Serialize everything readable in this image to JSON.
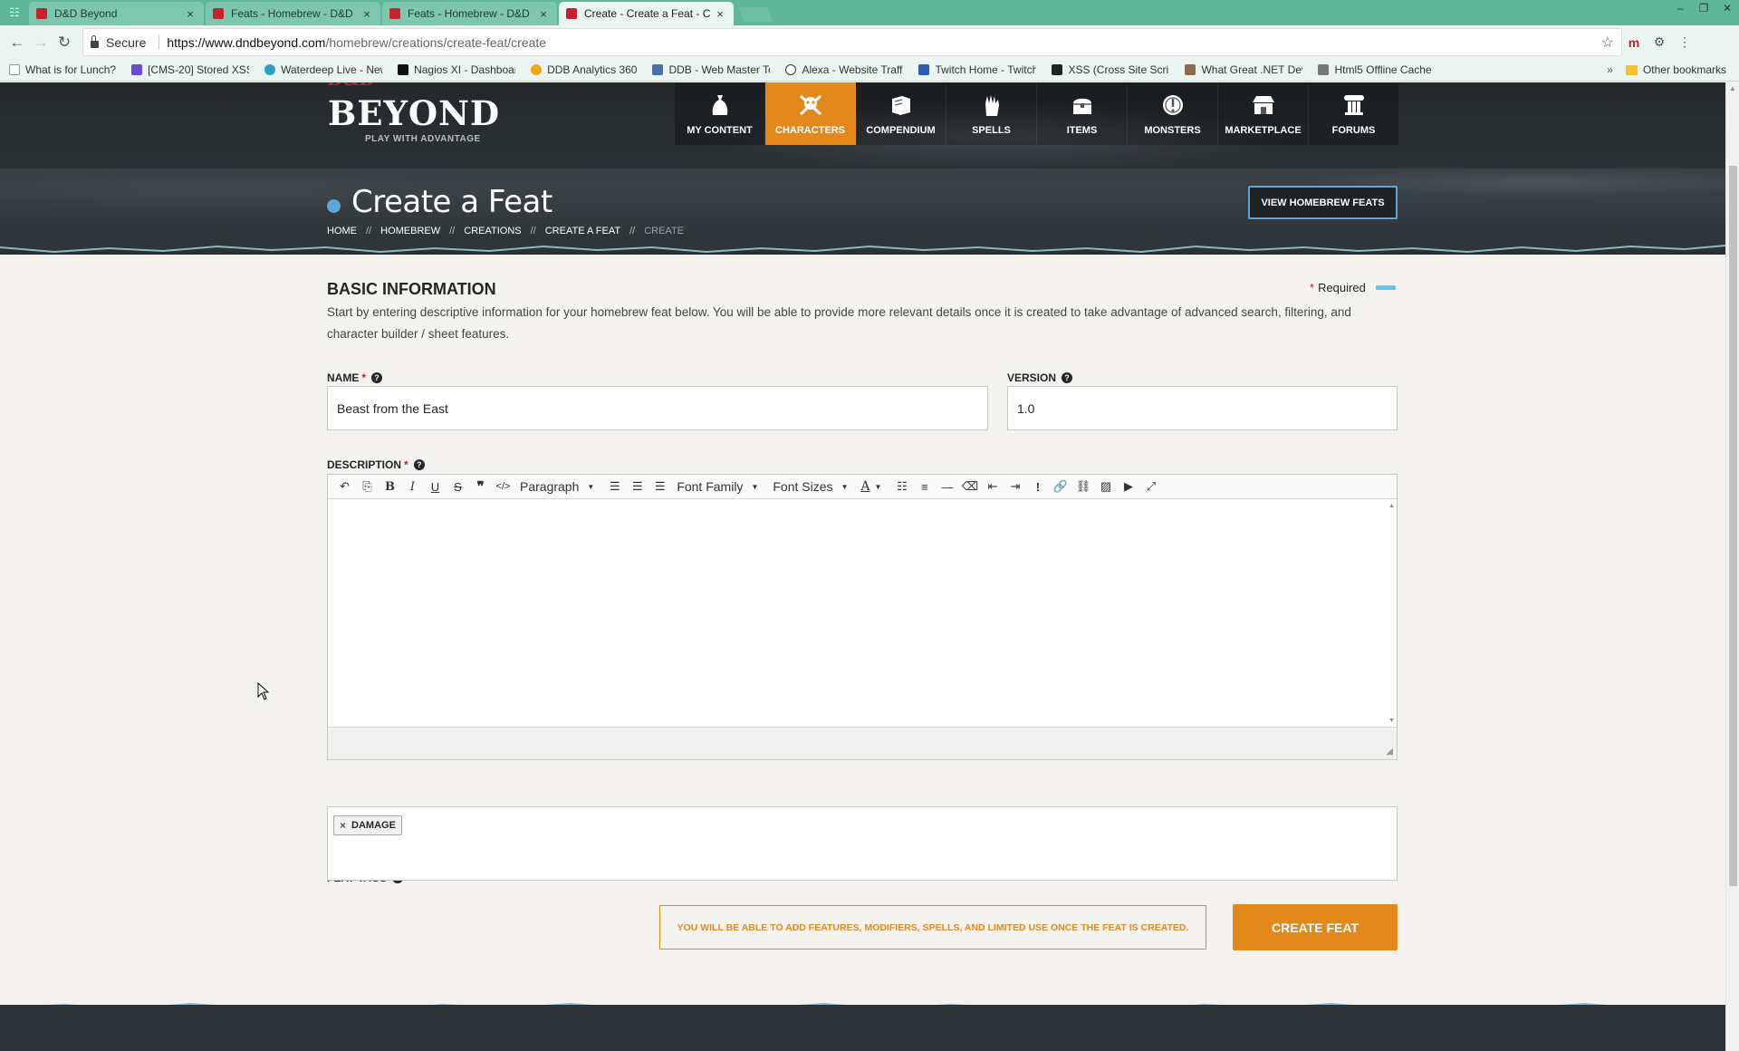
{
  "browser": {
    "tabs": [
      {
        "title": "D&D Beyond",
        "active": false
      },
      {
        "title": "Feats - Homebrew - D&D",
        "active": false
      },
      {
        "title": "Feats - Homebrew - D&D",
        "active": false
      },
      {
        "title": "Create - Create a Feat - C",
        "active": true
      }
    ],
    "secure_label": "Secure",
    "url_host": "https://www.dndbeyond.com",
    "url_path": "/homebrew/creations/create-feat/create",
    "bookmarks": [
      {
        "label": "What is for Lunch?",
        "icon": "page-icon",
        "color": "#ffffff"
      },
      {
        "label": "[CMS-20] Stored XSS",
        "icon": "jira-icon",
        "color": "#6b4bd6"
      },
      {
        "label": "Waterdeep Live - New",
        "icon": "globe-icon",
        "color": "#2aa0c9"
      },
      {
        "label": "Nagios XI - Dashboard",
        "icon": "nagios-icon",
        "color": "#111111"
      },
      {
        "label": "DDB Analytics 360",
        "icon": "analytics-icon",
        "color": "#f2a71b"
      },
      {
        "label": "DDB - Web Master To",
        "icon": "car-icon",
        "color": "#4a6ea9"
      },
      {
        "label": "Alexa - Website Traffi",
        "icon": "alexa-icon",
        "color": "#333333"
      },
      {
        "label": "Twitch Home - Twitch",
        "icon": "twitch-icon",
        "color": "#2a5db0"
      },
      {
        "label": "XSS (Cross Site Script",
        "icon": "rs-icon",
        "color": "#222222"
      },
      {
        "label": "What Great .NET Dev",
        "icon": "person-icon",
        "color": "#8a6a4a"
      },
      {
        "label": "Html5 Offline Cache",
        "icon": "page-icon",
        "color": "#777777"
      }
    ],
    "other_bookmarks": "Other bookmarks",
    "more": "»"
  },
  "site": {
    "logo_ddb": "D&D",
    "logo_word": "BEYOND",
    "logo_tagline": "PLAY WITH ADVANTAGE",
    "nav": [
      {
        "label": "MY CONTENT",
        "icon": "bag-icon",
        "active": false
      },
      {
        "label": "CHARACTERS",
        "icon": "skull-crossbones-icon",
        "active": true
      },
      {
        "label": "COMPENDIUM",
        "icon": "book-icon",
        "active": false
      },
      {
        "label": "SPELLS",
        "icon": "hand-magic-icon",
        "active": false
      },
      {
        "label": "ITEMS",
        "icon": "chest-icon",
        "active": false
      },
      {
        "label": "MONSTERS",
        "icon": "monster-icon",
        "active": false
      },
      {
        "label": "MARKETPLACE",
        "icon": "store-icon",
        "active": false
      },
      {
        "label": "FORUMS",
        "icon": "pillar-icon",
        "active": false
      }
    ]
  },
  "header": {
    "title": "Create a Feat",
    "view_button": "VIEW HOMEBREW FEATS",
    "breadcrumbs": [
      "HOME",
      "HOMEBREW",
      "CREATIONS",
      "CREATE A FEAT",
      "CREATE"
    ],
    "divider": "//"
  },
  "form": {
    "section_title": "BASIC INFORMATION",
    "required_star": "*",
    "required_label": "Required",
    "intro": "Start by entering descriptive information for your homebrew feat below. You will be able to provide more relevant details once it is created to take advantage of advanced search, filtering, and character builder / sheet features.",
    "name": {
      "label": "NAME",
      "value": "Beast from the East",
      "required": true
    },
    "version": {
      "label": "VERSION",
      "value": "1.0"
    },
    "description": {
      "label": "DESCRIPTION",
      "value": "",
      "toolbar": {
        "paragraph": "Paragraph",
        "font_family": "Font Family",
        "font_sizes": "Font Sizes",
        "text_color": "A"
      }
    },
    "feat_tags": {
      "label": "FEAT TAGS",
      "tags": [
        "DAMAGE"
      ],
      "remove_glyph": "×"
    },
    "notice": "YOU WILL BE ABLE TO ADD FEATURES, MODIFIERS, SPELLS, AND LIMITED USE ONCE THE FEAT IS CREATED.",
    "submit": "CREATE FEAT"
  },
  "colors": {
    "accent_orange": "#e3891b",
    "accent_blue": "#5aa8d8",
    "required_red": "#c0232c",
    "tabstrip_green": "#5fb79a"
  }
}
